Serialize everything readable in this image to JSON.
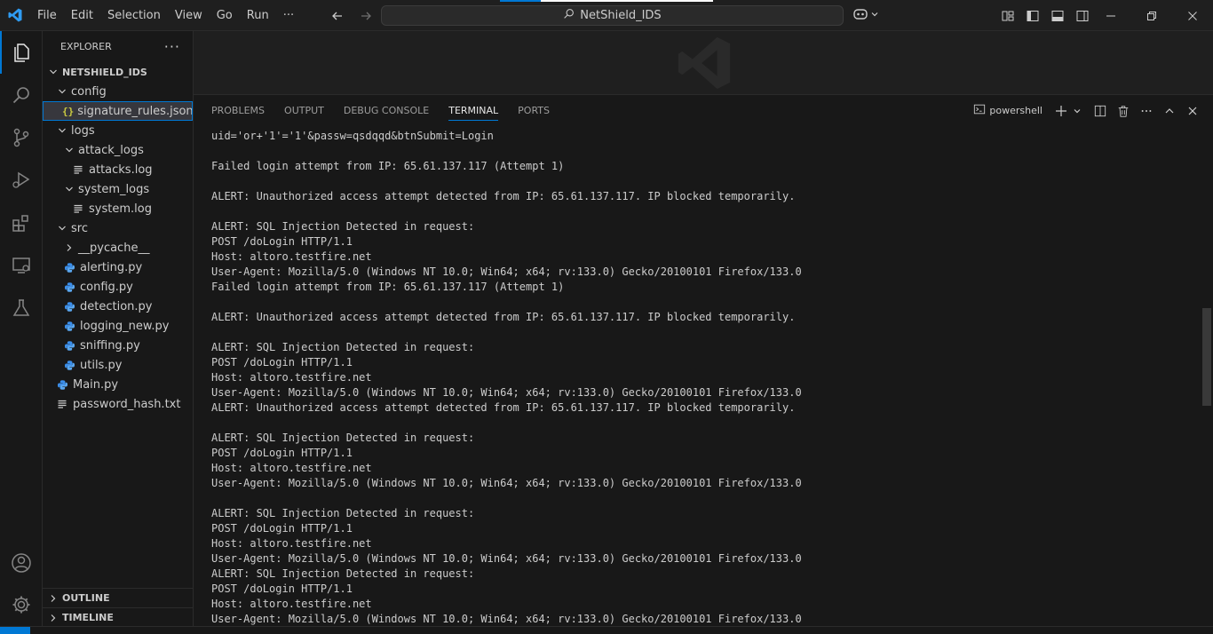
{
  "menu": [
    "File",
    "Edit",
    "Selection",
    "View",
    "Go",
    "Run",
    "···"
  ],
  "command_center": "NetShield_IDS",
  "sidebar": {
    "title": "EXPLORER",
    "more": "···",
    "root": "NETSHIELD_IDS",
    "tree": [
      {
        "label": "config",
        "type": "folder"
      },
      {
        "label": "signature_rules.json",
        "type": "json"
      },
      {
        "label": "logs",
        "type": "folder"
      },
      {
        "label": "attack_logs",
        "type": "folder"
      },
      {
        "label": "attacks.log",
        "type": "text"
      },
      {
        "label": "system_logs",
        "type": "folder"
      },
      {
        "label": "system.log",
        "type": "text"
      },
      {
        "label": "src",
        "type": "folder"
      },
      {
        "label": "__pycache__",
        "type": "folder-closed"
      },
      {
        "label": "alerting.py",
        "type": "python"
      },
      {
        "label": "config.py",
        "type": "python"
      },
      {
        "label": "detection.py",
        "type": "python"
      },
      {
        "label": "logging_new.py",
        "type": "python"
      },
      {
        "label": "sniffing.py",
        "type": "python"
      },
      {
        "label": "utils.py",
        "type": "python"
      },
      {
        "label": "Main.py",
        "type": "python"
      },
      {
        "label": "password_hash.txt",
        "type": "text"
      }
    ],
    "outline": "OUTLINE",
    "timeline": "TIMELINE"
  },
  "panel": {
    "tabs": [
      "PROBLEMS",
      "OUTPUT",
      "DEBUG CONSOLE",
      "TERMINAL",
      "PORTS"
    ],
    "active_tab": "TERMINAL",
    "shell": "powershell"
  },
  "terminal": [
    "uid='or+'1'='1'&passw=qsdqqd&btnSubmit=Login",
    "",
    "Failed login attempt from IP: 65.61.137.117 (Attempt 1)",
    "",
    "ALERT: Unauthorized access attempt detected from IP: 65.61.137.117. IP blocked temporarily.",
    "",
    "ALERT: SQL Injection Detected in request:",
    "POST /doLogin HTTP/1.1",
    "Host: altoro.testfire.net",
    "User-Agent: Mozilla/5.0 (Windows NT 10.0; Win64; x64; rv:133.0) Gecko/20100101 Firefox/133.0",
    "Failed login attempt from IP: 65.61.137.117 (Attempt 1)",
    "",
    "ALERT: Unauthorized access attempt detected from IP: 65.61.137.117. IP blocked temporarily.",
    "",
    "ALERT: SQL Injection Detected in request:",
    "POST /doLogin HTTP/1.1",
    "Host: altoro.testfire.net",
    "User-Agent: Mozilla/5.0 (Windows NT 10.0; Win64; x64; rv:133.0) Gecko/20100101 Firefox/133.0",
    "ALERT: Unauthorized access attempt detected from IP: 65.61.137.117. IP blocked temporarily.",
    "",
    "ALERT: SQL Injection Detected in request:",
    "POST /doLogin HTTP/1.1",
    "Host: altoro.testfire.net",
    "User-Agent: Mozilla/5.0 (Windows NT 10.0; Win64; x64; rv:133.0) Gecko/20100101 Firefox/133.0",
    "",
    "ALERT: SQL Injection Detected in request:",
    "POST /doLogin HTTP/1.1",
    "Host: altoro.testfire.net",
    "User-Agent: Mozilla/5.0 (Windows NT 10.0; Win64; x64; rv:133.0) Gecko/20100101 Firefox/133.0",
    "ALERT: SQL Injection Detected in request:",
    "POST /doLogin HTTP/1.1",
    "Host: altoro.testfire.net",
    "User-Agent: Mozilla/5.0 (Windows NT 10.0; Win64; x64; rv:133.0) Gecko/20100101 Firefox/133.0"
  ],
  "colors": {
    "accent": "#0078d4",
    "json_icon": "#cbcb41",
    "python_icon": "#3b8eea"
  }
}
